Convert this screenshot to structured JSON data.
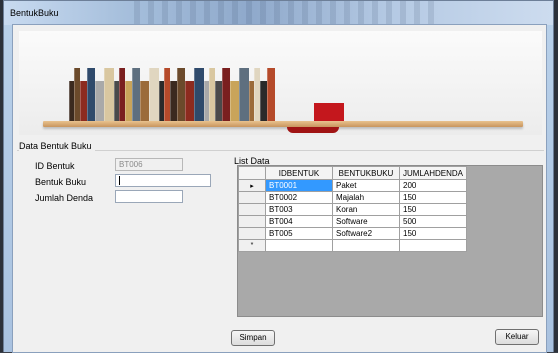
{
  "window": {
    "title": "BentukBuku"
  },
  "group": {
    "legend": "Data Bentuk Buku",
    "fields": {
      "id_label": "ID Bentuk",
      "id_value": "BT006",
      "bentuk_label": "Bentuk Buku",
      "bentuk_value": "",
      "denda_label": "Jumlah Denda",
      "denda_value": ""
    },
    "list_label": "List Data",
    "grid": {
      "columns": [
        "IDBENTUK",
        "BENTUKBUKU",
        "JUMLAHDENDA"
      ],
      "rows": [
        [
          "BT0001",
          "Paket",
          "200"
        ],
        [
          "BT0002",
          "Majalah",
          "150"
        ],
        [
          "BT003",
          "Koran",
          "150"
        ],
        [
          "BT004",
          "Software",
          "500"
        ],
        [
          "BT005",
          "Software2",
          "150"
        ]
      ],
      "current_row_indicator": "▸",
      "new_row_indicator": "*",
      "selected_color": "#3399ff"
    },
    "buttons": {
      "save": "Simpan",
      "exit": "Keluar"
    }
  }
}
